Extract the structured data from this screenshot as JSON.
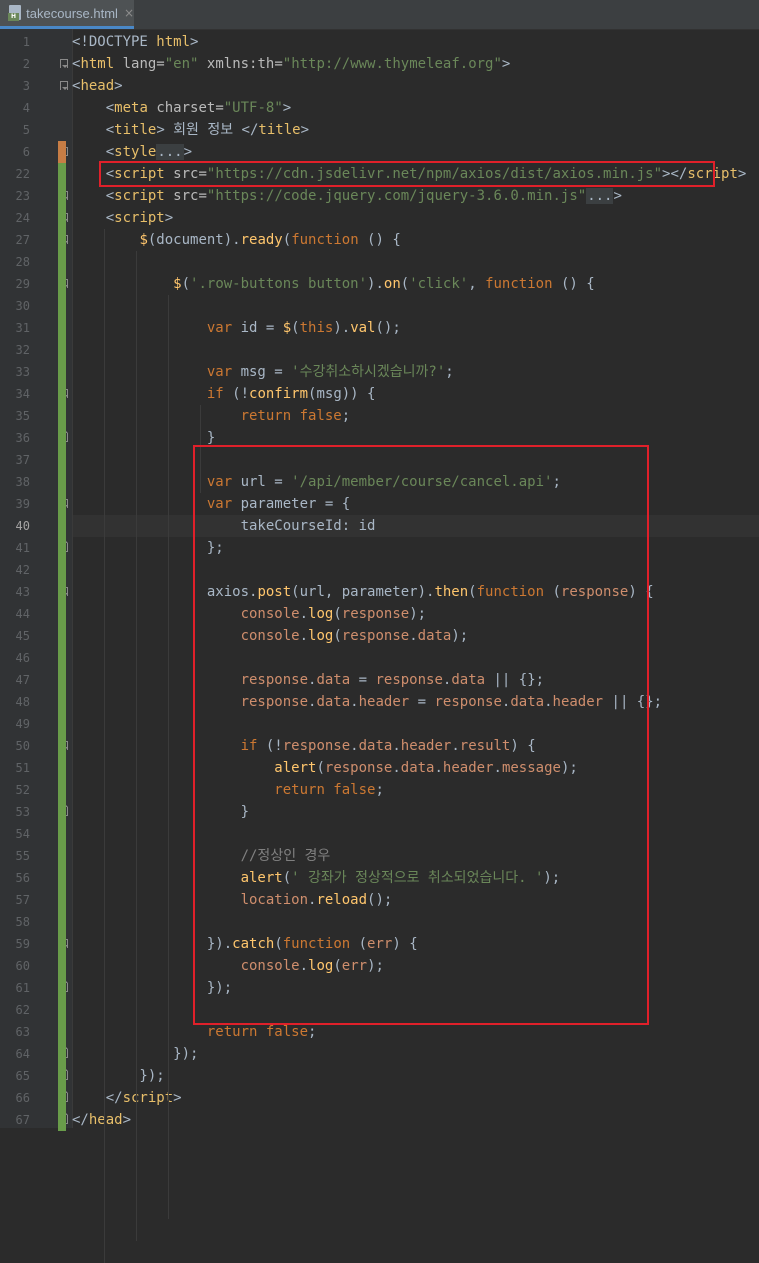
{
  "tab": {
    "file_name": "takecourse.html",
    "close_glyph": "×",
    "icon": "html-file-icon"
  },
  "colors": {
    "highlight_border": "#e0202a",
    "change_bar": "#699c4a",
    "change_bar_modified": "#c77d45",
    "background": "#2b2b2b"
  },
  "lines": [
    {
      "n": "1",
      "segs": [
        [
          "t-plain",
          "<!DOCTYPE "
        ],
        [
          "t-tag",
          "html"
        ],
        [
          "t-plain",
          ">"
        ]
      ]
    },
    {
      "n": "2",
      "segs": [
        [
          "t-plain",
          "<"
        ],
        [
          "t-tag",
          "html "
        ],
        [
          "t-attr",
          "lang="
        ],
        [
          "t-str",
          "\"en\" "
        ],
        [
          "t-attr",
          "xmlns:th="
        ],
        [
          "t-str",
          "\"http://www.thymeleaf.org\""
        ],
        [
          "t-plain",
          ">"
        ]
      ]
    },
    {
      "n": "3",
      "segs": [
        [
          "t-plain",
          "<"
        ],
        [
          "t-tag",
          "head"
        ],
        [
          "t-plain",
          ">"
        ]
      ]
    },
    {
      "n": "4",
      "segs": [
        [
          "t-plain",
          "    <"
        ],
        [
          "t-tag",
          "meta "
        ],
        [
          "t-attr",
          "charset="
        ],
        [
          "t-str",
          "\"UTF-8\""
        ],
        [
          "t-plain",
          ">"
        ]
      ]
    },
    {
      "n": "5",
      "segs": [
        [
          "t-plain",
          "    <"
        ],
        [
          "t-tag",
          "title"
        ],
        [
          "t-plain",
          "> 회원 정보 </"
        ],
        [
          "t-tag",
          "title"
        ],
        [
          "t-plain",
          ">"
        ]
      ]
    },
    {
      "n": "6",
      "segs": [
        [
          "t-plain",
          "    <"
        ],
        [
          "t-tag",
          "style"
        ],
        [
          "t-fold",
          "..."
        ],
        [
          "t-plain",
          ">"
        ]
      ]
    },
    {
      "n": "22",
      "segs": [
        [
          "t-plain",
          "    <"
        ],
        [
          "t-tag",
          "script "
        ],
        [
          "t-attr",
          "src="
        ],
        [
          "t-str",
          "\"https://cdn.jsdelivr.net/npm/axios/dist/axios.min.js\""
        ],
        [
          "t-plain",
          "></"
        ],
        [
          "t-tag",
          "script"
        ],
        [
          "t-plain",
          ">"
        ]
      ]
    },
    {
      "n": "23",
      "segs": [
        [
          "t-plain",
          "    <"
        ],
        [
          "t-tag",
          "script "
        ],
        [
          "t-attr",
          "src="
        ],
        [
          "t-str",
          "\"https://code.jquery.com/jquery-3.6.0.min.js\""
        ],
        [
          "t-fold",
          "..."
        ],
        [
          "t-plain",
          ">"
        ]
      ]
    },
    {
      "n": "24",
      "segs": [
        [
          "t-plain",
          "    <"
        ],
        [
          "t-tag",
          "script"
        ],
        [
          "t-plain",
          ">"
        ]
      ]
    },
    {
      "n": "27",
      "segs": [
        [
          "t-plain",
          "        "
        ],
        [
          "t-fn",
          "$"
        ],
        [
          "t-plain",
          "(document)."
        ],
        [
          "t-fn",
          "ready"
        ],
        [
          "t-plain",
          "("
        ],
        [
          "t-kw",
          "function "
        ],
        [
          "t-plain",
          "() {"
        ]
      ]
    },
    {
      "n": "28",
      "segs": []
    },
    {
      "n": "29",
      "segs": [
        [
          "t-plain",
          "            "
        ],
        [
          "t-fn",
          "$"
        ],
        [
          "t-plain",
          "("
        ],
        [
          "t-str",
          "'.row-buttons button'"
        ],
        [
          "t-plain",
          ")."
        ],
        [
          "t-fn",
          "on"
        ],
        [
          "t-plain",
          "("
        ],
        [
          "t-str",
          "'click'"
        ],
        [
          "t-plain",
          ", "
        ],
        [
          "t-kw",
          "function "
        ],
        [
          "t-plain",
          "() {"
        ]
      ]
    },
    {
      "n": "30",
      "segs": []
    },
    {
      "n": "31",
      "segs": [
        [
          "t-plain",
          "                "
        ],
        [
          "t-kw",
          "var "
        ],
        [
          "t-plain",
          "id = "
        ],
        [
          "t-fn",
          "$"
        ],
        [
          "t-plain",
          "("
        ],
        [
          "t-kw",
          "this"
        ],
        [
          "t-plain",
          ")."
        ],
        [
          "t-fn",
          "val"
        ],
        [
          "t-plain",
          "();"
        ]
      ]
    },
    {
      "n": "32",
      "segs": []
    },
    {
      "n": "33",
      "segs": [
        [
          "t-plain",
          "                "
        ],
        [
          "t-kw",
          "var "
        ],
        [
          "t-plain",
          "msg = "
        ],
        [
          "t-str",
          "'수강취소하시겠습니까?'"
        ],
        [
          "t-plain",
          ";"
        ]
      ]
    },
    {
      "n": "34",
      "segs": [
        [
          "t-plain",
          "                "
        ],
        [
          "t-kw",
          "if "
        ],
        [
          "t-plain",
          "(!"
        ],
        [
          "t-fn",
          "confirm"
        ],
        [
          "t-plain",
          "(msg)) {"
        ]
      ]
    },
    {
      "n": "35",
      "segs": [
        [
          "t-plain",
          "                    "
        ],
        [
          "t-kw",
          "return false"
        ],
        [
          "t-plain",
          ";"
        ]
      ]
    },
    {
      "n": "36",
      "segs": [
        [
          "t-plain",
          "                }"
        ]
      ]
    },
    {
      "n": "37",
      "segs": []
    },
    {
      "n": "38",
      "segs": [
        [
          "t-plain",
          "                "
        ],
        [
          "t-kw",
          "var "
        ],
        [
          "t-plain",
          "url = "
        ],
        [
          "t-str",
          "'/api/member/course/cancel.api'"
        ],
        [
          "t-plain",
          ";"
        ]
      ]
    },
    {
      "n": "39",
      "segs": [
        [
          "t-plain",
          "                "
        ],
        [
          "t-kw",
          "var "
        ],
        [
          "t-plain",
          "parameter = {"
        ]
      ]
    },
    {
      "n": "40",
      "segs": [
        [
          "t-plain",
          "                    takeCourseId: "
        ],
        [
          "t-plain",
          "id"
        ]
      ]
    },
    {
      "n": "41",
      "segs": [
        [
          "t-plain",
          "                };"
        ]
      ]
    },
    {
      "n": "42",
      "segs": []
    },
    {
      "n": "43",
      "segs": [
        [
          "t-plain",
          "                axios."
        ],
        [
          "t-fn",
          "post"
        ],
        [
          "t-plain",
          "(url, parameter)."
        ],
        [
          "t-fn",
          "then"
        ],
        [
          "t-plain",
          "("
        ],
        [
          "t-kw",
          "function "
        ],
        [
          "t-plain",
          "("
        ],
        [
          "t-obj",
          "response"
        ],
        [
          "t-plain",
          ") {"
        ]
      ]
    },
    {
      "n": "44",
      "segs": [
        [
          "t-plain",
          "                    "
        ],
        [
          "t-obj",
          "console"
        ],
        [
          "t-plain",
          "."
        ],
        [
          "t-fn",
          "log"
        ],
        [
          "t-plain",
          "("
        ],
        [
          "t-obj",
          "response"
        ],
        [
          "t-plain",
          ");"
        ]
      ]
    },
    {
      "n": "45",
      "segs": [
        [
          "t-plain",
          "                    "
        ],
        [
          "t-obj",
          "console"
        ],
        [
          "t-plain",
          "."
        ],
        [
          "t-fn",
          "log"
        ],
        [
          "t-plain",
          "("
        ],
        [
          "t-obj",
          "response"
        ],
        [
          "t-plain",
          "."
        ],
        [
          "t-obj",
          "data"
        ],
        [
          "t-plain",
          ");"
        ]
      ]
    },
    {
      "n": "46",
      "segs": []
    },
    {
      "n": "47",
      "segs": [
        [
          "t-plain",
          "                    "
        ],
        [
          "t-obj",
          "response"
        ],
        [
          "t-plain",
          "."
        ],
        [
          "t-obj",
          "data"
        ],
        [
          "t-plain",
          " = "
        ],
        [
          "t-obj",
          "response"
        ],
        [
          "t-plain",
          "."
        ],
        [
          "t-obj",
          "data"
        ],
        [
          "t-plain",
          " || {};"
        ]
      ]
    },
    {
      "n": "48",
      "segs": [
        [
          "t-plain",
          "                    "
        ],
        [
          "t-obj",
          "response"
        ],
        [
          "t-plain",
          "."
        ],
        [
          "t-obj",
          "data"
        ],
        [
          "t-plain",
          "."
        ],
        [
          "t-obj",
          "header"
        ],
        [
          "t-plain",
          " = "
        ],
        [
          "t-obj",
          "response"
        ],
        [
          "t-plain",
          "."
        ],
        [
          "t-obj",
          "data"
        ],
        [
          "t-plain",
          "."
        ],
        [
          "t-obj",
          "header"
        ],
        [
          "t-plain",
          " || {};"
        ]
      ]
    },
    {
      "n": "49",
      "segs": []
    },
    {
      "n": "50",
      "segs": [
        [
          "t-plain",
          "                    "
        ],
        [
          "t-kw",
          "if "
        ],
        [
          "t-plain",
          "(!"
        ],
        [
          "t-obj",
          "response"
        ],
        [
          "t-plain",
          "."
        ],
        [
          "t-obj",
          "data"
        ],
        [
          "t-plain",
          "."
        ],
        [
          "t-obj",
          "header"
        ],
        [
          "t-plain",
          "."
        ],
        [
          "t-obj",
          "result"
        ],
        [
          "t-plain",
          ") {"
        ]
      ]
    },
    {
      "n": "51",
      "segs": [
        [
          "t-plain",
          "                        "
        ],
        [
          "t-fn",
          "alert"
        ],
        [
          "t-plain",
          "("
        ],
        [
          "t-obj",
          "response"
        ],
        [
          "t-plain",
          "."
        ],
        [
          "t-obj",
          "data"
        ],
        [
          "t-plain",
          "."
        ],
        [
          "t-obj",
          "header"
        ],
        [
          "t-plain",
          "."
        ],
        [
          "t-obj",
          "message"
        ],
        [
          "t-plain",
          ");"
        ]
      ]
    },
    {
      "n": "52",
      "segs": [
        [
          "t-plain",
          "                        "
        ],
        [
          "t-kw",
          "return false"
        ],
        [
          "t-plain",
          ";"
        ]
      ]
    },
    {
      "n": "53",
      "segs": [
        [
          "t-plain",
          "                    }"
        ]
      ]
    },
    {
      "n": "54",
      "segs": []
    },
    {
      "n": "55",
      "segs": [
        [
          "t-plain",
          "                    "
        ],
        [
          "t-cmt",
          "//정상인 경우"
        ]
      ]
    },
    {
      "n": "56",
      "segs": [
        [
          "t-plain",
          "                    "
        ],
        [
          "t-fn",
          "alert"
        ],
        [
          "t-plain",
          "("
        ],
        [
          "t-str",
          "' 강좌가 정상적으로 취소되었습니다. '"
        ],
        [
          "t-plain",
          ");"
        ]
      ]
    },
    {
      "n": "57",
      "segs": [
        [
          "t-plain",
          "                    "
        ],
        [
          "t-obj",
          "location"
        ],
        [
          "t-plain",
          "."
        ],
        [
          "t-fn",
          "reload"
        ],
        [
          "t-plain",
          "();"
        ]
      ]
    },
    {
      "n": "58",
      "segs": []
    },
    {
      "n": "59",
      "segs": [
        [
          "t-plain",
          "                })."
        ],
        [
          "t-fn",
          "catch"
        ],
        [
          "t-plain",
          "("
        ],
        [
          "t-kw",
          "function "
        ],
        [
          "t-plain",
          "("
        ],
        [
          "t-obj",
          "err"
        ],
        [
          "t-plain",
          ") {"
        ]
      ]
    },
    {
      "n": "60",
      "segs": [
        [
          "t-plain",
          "                    "
        ],
        [
          "t-obj",
          "console"
        ],
        [
          "t-plain",
          "."
        ],
        [
          "t-fn",
          "log"
        ],
        [
          "t-plain",
          "("
        ],
        [
          "t-obj",
          "err"
        ],
        [
          "t-plain",
          ");"
        ]
      ]
    },
    {
      "n": "61",
      "segs": [
        [
          "t-plain",
          "                });"
        ]
      ]
    },
    {
      "n": "62",
      "segs": []
    },
    {
      "n": "63",
      "segs": [
        [
          "t-plain",
          "                "
        ],
        [
          "t-kw",
          "return false"
        ],
        [
          "t-plain",
          ";"
        ]
      ]
    },
    {
      "n": "64",
      "segs": [
        [
          "t-plain",
          "            });"
        ]
      ]
    },
    {
      "n": "65",
      "segs": [
        [
          "t-plain",
          "        });"
        ]
      ]
    },
    {
      "n": "66",
      "segs": [
        [
          "t-plain",
          "    </"
        ],
        [
          "t-tag",
          "script"
        ],
        [
          "t-plain",
          ">"
        ]
      ]
    },
    {
      "n": "67",
      "segs": [
        [
          "t-plain",
          "</"
        ],
        [
          "t-tag",
          "head"
        ],
        [
          "t-plain",
          ">"
        ]
      ]
    }
  ]
}
